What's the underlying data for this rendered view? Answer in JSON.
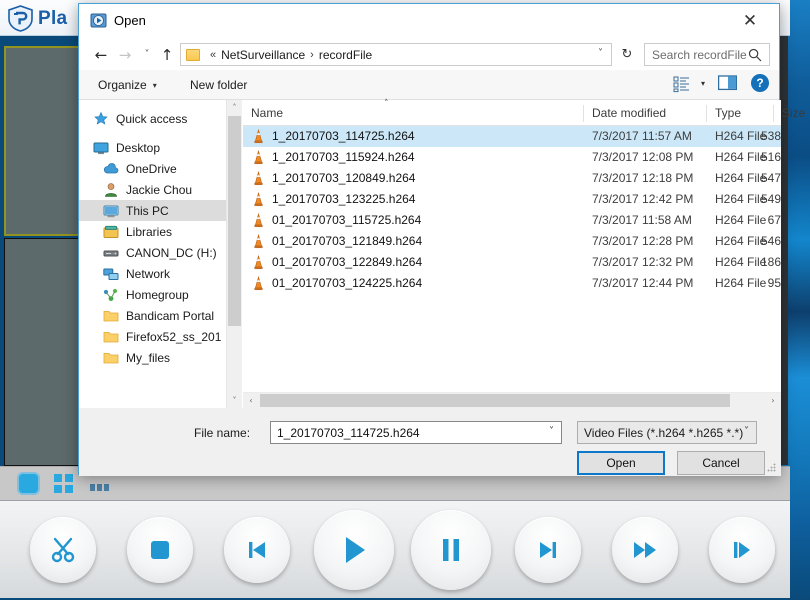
{
  "background_app": {
    "name": "Pla",
    "logo_icon": "shield-logo-icon",
    "close_icon": "close-icon",
    "video_panels": [
      {
        "name": "video-panel-1",
        "selected": true
      },
      {
        "name": "video-panel-2",
        "selected": false
      }
    ],
    "taskbar_icons": [
      "stop-square-icon",
      "grid-view-icon",
      "dots-icon"
    ],
    "controls": [
      {
        "name": "cut-button",
        "icon": "scissors-icon"
      },
      {
        "name": "stop-button",
        "icon": "stop-square-icon"
      },
      {
        "name": "previous-button",
        "icon": "skip-previous-icon"
      },
      {
        "name": "play-button",
        "icon": "play-icon"
      },
      {
        "name": "pause-button",
        "icon": "pause-icon"
      },
      {
        "name": "next-button",
        "icon": "skip-next-icon"
      },
      {
        "name": "fast-forward-button",
        "icon": "fast-forward-icon"
      },
      {
        "name": "frame-step-button",
        "icon": "frame-step-icon"
      }
    ]
  },
  "dialog": {
    "title": "Open",
    "title_icon": "media-player-icon",
    "close_label": "✕",
    "nav": {
      "back_label": "←",
      "forward_label": "→",
      "recent_label": "˅",
      "up_label": "↑",
      "breadcrumb_prefix": "«",
      "breadcrumb": [
        "NetSurveillance",
        "recordFile"
      ],
      "breadcrumb_separator": "›",
      "dropdown_label": "˅",
      "refresh_label": "↻",
      "search_placeholder": "Search recordFile"
    },
    "toolbar": {
      "organize_label": "Organize",
      "new_folder_label": "New folder",
      "caret_label": "▾",
      "view_icon": "view-options-icon",
      "preview_icon": "preview-pane-icon",
      "help_label": "?"
    },
    "sidebar": {
      "items": [
        {
          "label": "Quick access",
          "icon": "star-icon",
          "indent": false,
          "selected": false
        },
        {
          "label": "Desktop",
          "icon": "desktop-icon",
          "indent": false,
          "selected": false
        },
        {
          "label": "OneDrive",
          "icon": "cloud-icon",
          "indent": true,
          "selected": false
        },
        {
          "label": "Jackie Chou",
          "icon": "user-icon",
          "indent": true,
          "selected": false
        },
        {
          "label": "This PC",
          "icon": "computer-icon",
          "indent": true,
          "selected": true
        },
        {
          "label": "Libraries",
          "icon": "libraries-icon",
          "indent": true,
          "selected": false
        },
        {
          "label": "CANON_DC (H:)",
          "icon": "drive-icon",
          "indent": true,
          "selected": false
        },
        {
          "label": "Network",
          "icon": "network-icon",
          "indent": true,
          "selected": false
        },
        {
          "label": "Homegroup",
          "icon": "homegroup-icon",
          "indent": true,
          "selected": false
        },
        {
          "label": "Bandicam Portal",
          "icon": "folder-icon",
          "indent": true,
          "selected": false
        },
        {
          "label": "Firefox52_ss_201",
          "icon": "folder-icon",
          "indent": true,
          "selected": false
        },
        {
          "label": "My_files",
          "icon": "folder-icon",
          "indent": true,
          "selected": false
        }
      ],
      "scroll_up_label": "˄",
      "scroll_down_label": "˅"
    },
    "file_list": {
      "columns": [
        "Name",
        "Date modified",
        "Type",
        "Size"
      ],
      "sort_indicator": "˄",
      "rows": [
        {
          "name": "1_20170703_114725.h264",
          "date": "7/3/2017 11:57 AM",
          "type": "H264 File",
          "size": "538",
          "selected": true
        },
        {
          "name": "1_20170703_115924.h264",
          "date": "7/3/2017 12:08 PM",
          "type": "H264 File",
          "size": "516",
          "selected": false
        },
        {
          "name": "1_20170703_120849.h264",
          "date": "7/3/2017 12:18 PM",
          "type": "H264 File",
          "size": "547",
          "selected": false
        },
        {
          "name": "1_20170703_123225.h264",
          "date": "7/3/2017 12:42 PM",
          "type": "H264 File",
          "size": "549",
          "selected": false
        },
        {
          "name": "01_20170703_115725.h264",
          "date": "7/3/2017 11:58 AM",
          "type": "H264 File",
          "size": "67",
          "selected": false
        },
        {
          "name": "01_20170703_121849.h264",
          "date": "7/3/2017 12:28 PM",
          "type": "H264 File",
          "size": "546",
          "selected": false
        },
        {
          "name": "01_20170703_122849.h264",
          "date": "7/3/2017 12:32 PM",
          "type": "H264 File",
          "size": "186",
          "selected": false
        },
        {
          "name": "01_20170703_124225.h264",
          "date": "7/3/2017 12:44 PM",
          "type": "H264 File",
          "size": "95",
          "selected": false
        }
      ],
      "file_icon": "vlc-cone-icon",
      "hscroll_left_label": "‹",
      "hscroll_right_label": "›"
    },
    "footer": {
      "file_name_label": "File name:",
      "file_name_value": "1_20170703_114725.h264",
      "file_name_caret": "˅",
      "file_type_value": "Video Files (*.h264 *.h265 *.*)",
      "file_type_caret": "˅",
      "open_label": "Open",
      "cancel_label": "Cancel"
    }
  },
  "colors": {
    "accent": "#0d78c9",
    "selection": "#cce8f8",
    "help_blue": "#1470b8",
    "control_glyph": "#2196d1",
    "panel_border_selected": "#93941f"
  }
}
